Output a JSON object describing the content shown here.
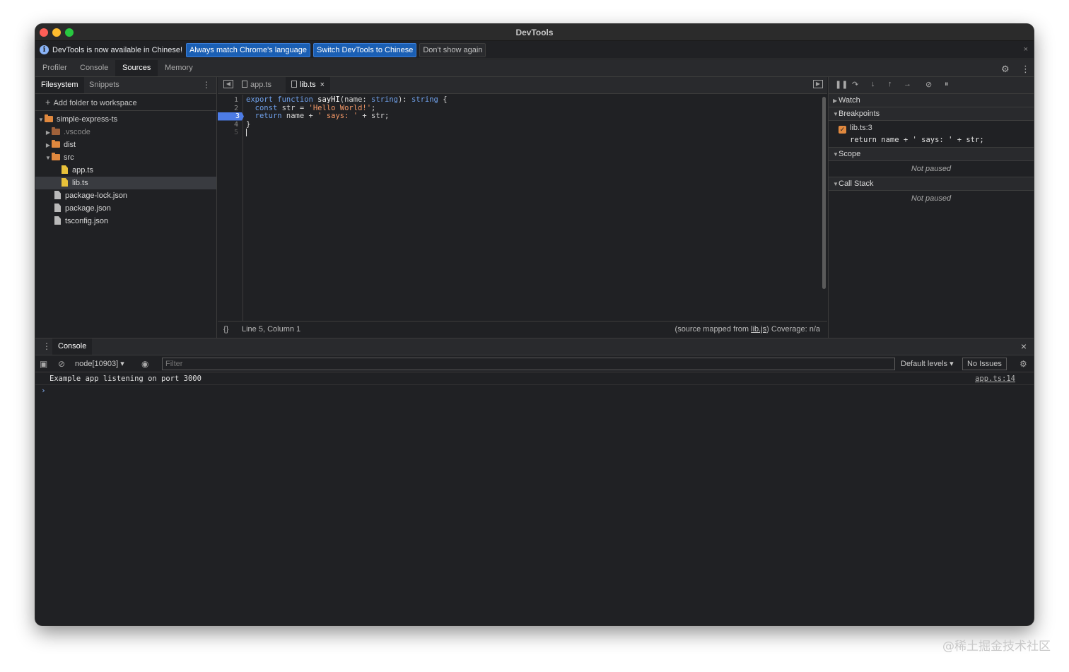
{
  "window": {
    "title": "DevTools"
  },
  "infobar": {
    "message": "DevTools is now available in Chinese!",
    "btn_match": "Always match Chrome's language",
    "btn_switch": "Switch DevTools to Chinese",
    "btn_dont_show": "Don't show again",
    "close": "×"
  },
  "main_tabs": [
    "Profiler",
    "Console",
    "Sources",
    "Memory"
  ],
  "active_main_tab": "Sources",
  "navigator": {
    "tabs": [
      "Filesystem",
      "Snippets"
    ],
    "add_folder": "Add folder to workspace",
    "tree": [
      {
        "label": "simple-express-ts",
        "type": "folder",
        "expanded": true
      },
      {
        "label": ".vscode",
        "type": "folder",
        "expanded": false
      },
      {
        "label": "dist",
        "type": "folder",
        "expanded": false
      },
      {
        "label": "src",
        "type": "folder",
        "expanded": true
      },
      {
        "label": "app.ts",
        "type": "file-ts"
      },
      {
        "label": "lib.ts",
        "type": "file-ts",
        "selected": true
      },
      {
        "label": "package-lock.json",
        "type": "file"
      },
      {
        "label": "package.json",
        "type": "file"
      },
      {
        "label": "tsconfig.json",
        "type": "file"
      }
    ]
  },
  "editor": {
    "tabs": [
      {
        "label": "app.ts"
      },
      {
        "label": "lib.ts",
        "active": true,
        "close": "×"
      }
    ],
    "line_numbers": [
      "1",
      "2",
      "3",
      "4",
      "5"
    ],
    "breakpoint_line": 3,
    "code": {
      "l1_kw1": "export",
      "l1_kw2": "function",
      "l1_name": "sayHI",
      "l1_p1": "(name: ",
      "l1_t1": "string",
      "l1_p2": "): ",
      "l1_t2": "string",
      "l1_p3": " {",
      "l2_kw": "const",
      "l2_p1": " str = ",
      "l2_str": "'Hello World!'",
      "l2_p2": ";",
      "l3_kw": "return",
      "l3_p1": " name + ",
      "l3_str": "' says: '",
      "l3_p2": " + str;",
      "l4": "}"
    },
    "status_braces": "{}",
    "status_position": "Line 5, Column 1",
    "mapped_prefix": "(source mapped from ",
    "mapped_link": "lib.js",
    "mapped_suffix": ")",
    "coverage": "Coverage: n/a"
  },
  "debugger": {
    "watch": "Watch",
    "breakpoints": "Breakpoints",
    "bp_location": "lib.ts:3",
    "bp_code": "return name + ' says: ' + str;",
    "scope": "Scope",
    "scope_status": "Not paused",
    "call_stack": "Call Stack",
    "call_stack_status": "Not paused"
  },
  "drawer": {
    "tab": "Console",
    "context": "node[10903]",
    "filter_placeholder": "Filter",
    "levels": "Default levels",
    "issues": "No Issues",
    "log_message": "Example app listening on port 3000",
    "log_source": "app.ts:14",
    "prompt": "›"
  },
  "watermark": "@稀土掘金技术社区"
}
